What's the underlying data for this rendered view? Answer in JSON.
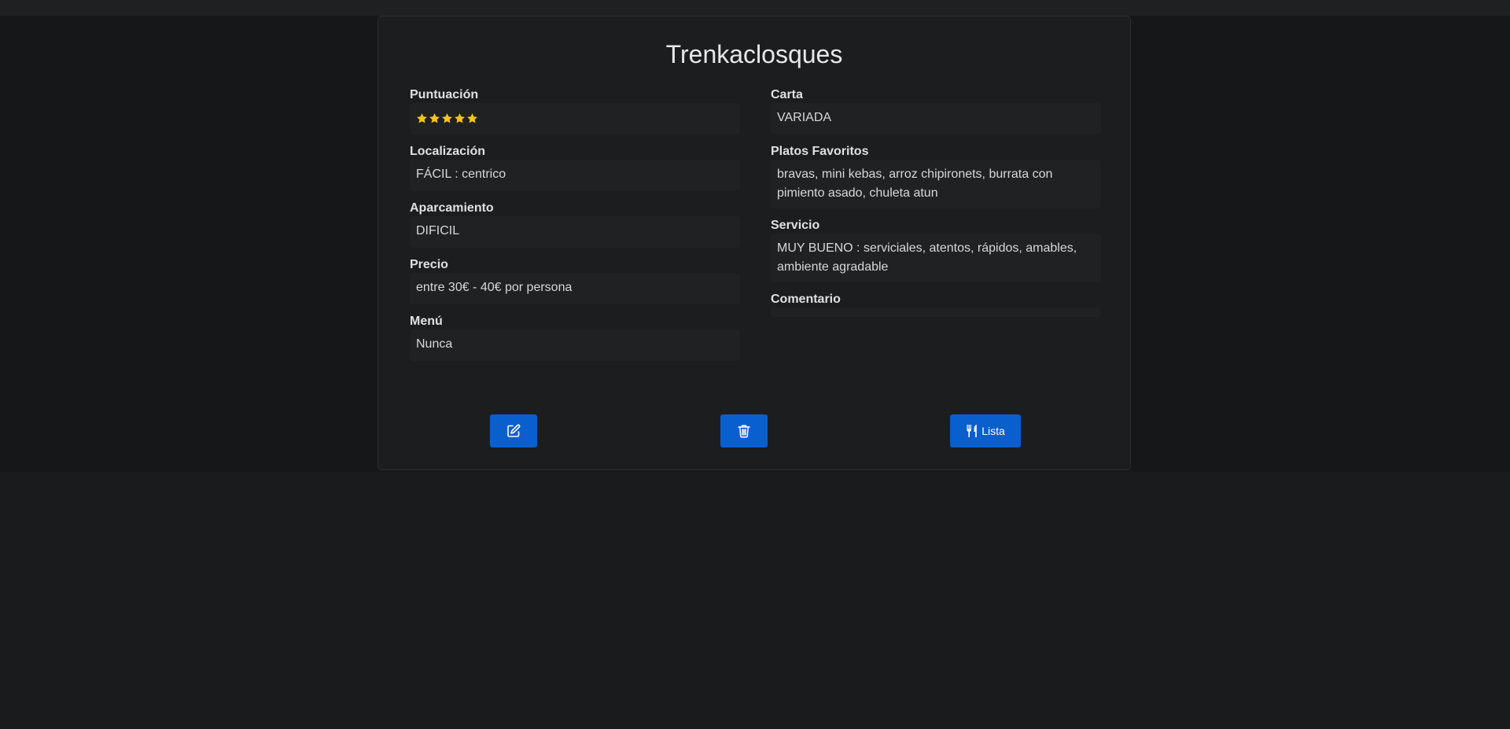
{
  "restaurant": {
    "name": "Trenkaclosques"
  },
  "fields_left": [
    {
      "label": "Puntuación",
      "rating": 5,
      "max_rating": 5
    },
    {
      "label": "Localización",
      "value": "FÁCIL : centrico"
    },
    {
      "label": "Aparcamiento",
      "value": "DIFICIL"
    },
    {
      "label": "Precio",
      "value": "entre 30€ - 40€ por persona"
    },
    {
      "label": "Menú",
      "value": "Nunca"
    }
  ],
  "fields_right": [
    {
      "label": "Carta",
      "value": "VARIADA"
    },
    {
      "label": "Platos Favoritos",
      "value": "bravas, mini kebas, arroz chipironets, burrata con pimiento asado, chuleta atun"
    },
    {
      "label": "Servicio",
      "value": "MUY BUENO : serviciales, atentos, rápidos, amables, ambiente agradable"
    },
    {
      "label": "Comentario",
      "value": ""
    }
  ],
  "actions": {
    "edit_icon": "pencil-square-icon",
    "delete_icon": "trash-icon",
    "list_icon": "utensils-icon",
    "list_label": "Lista"
  },
  "colors": {
    "accent": "#0a5fcf",
    "star": "#f5c518",
    "background": "#1a1b1d",
    "card": "#1c1d1f"
  }
}
